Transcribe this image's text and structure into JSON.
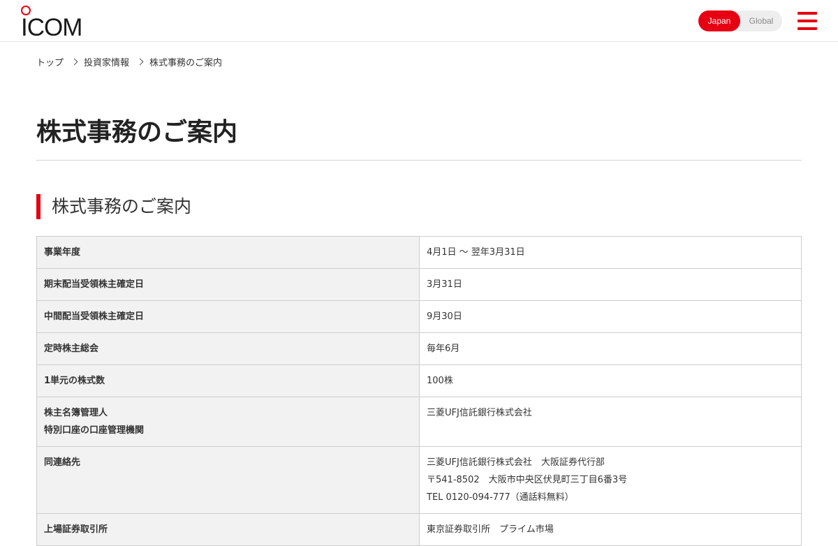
{
  "header": {
    "logo_text": "ICOM",
    "lang_japan": "Japan",
    "lang_global": "Global"
  },
  "breadcrumb": [
    "トップ",
    "投資家情報",
    "株式事務のご案内"
  ],
  "page_title": "株式事務のご案内",
  "section_title": "株式事務のご案内",
  "colors": {
    "accent": "#e60012"
  },
  "icons": {
    "menu": "hamburger-icon",
    "breadcrumb_sep": "chevron-right-icon"
  },
  "table": [
    {
      "label": [
        "事業年度"
      ],
      "value": [
        "4月1日 〜 翌年3月31日"
      ]
    },
    {
      "label": [
        "期末配当受領株主確定日"
      ],
      "value": [
        "3月31日"
      ]
    },
    {
      "label": [
        "中間配当受領株主確定日"
      ],
      "value": [
        "9月30日"
      ]
    },
    {
      "label": [
        "定時株主総会"
      ],
      "value": [
        "毎年6月"
      ]
    },
    {
      "label": [
        "1単元の株式数"
      ],
      "value": [
        "100株"
      ]
    },
    {
      "label": [
        "株主名簿管理人",
        "特別口座の口座管理機関"
      ],
      "value": [
        "三菱UFJ信託銀行株式会社"
      ]
    },
    {
      "label": [
        "同連絡先"
      ],
      "value": [
        "三菱UFJ信託銀行株式会社　大阪証券代行部",
        "〒541-8502　大阪市中央区伏見町三丁目6番3号",
        "TEL 0120-094-777（通話料無料）"
      ]
    },
    {
      "label": [
        "上場証券取引所"
      ],
      "value": [
        "東京証券取引所　プライム市場"
      ]
    }
  ]
}
